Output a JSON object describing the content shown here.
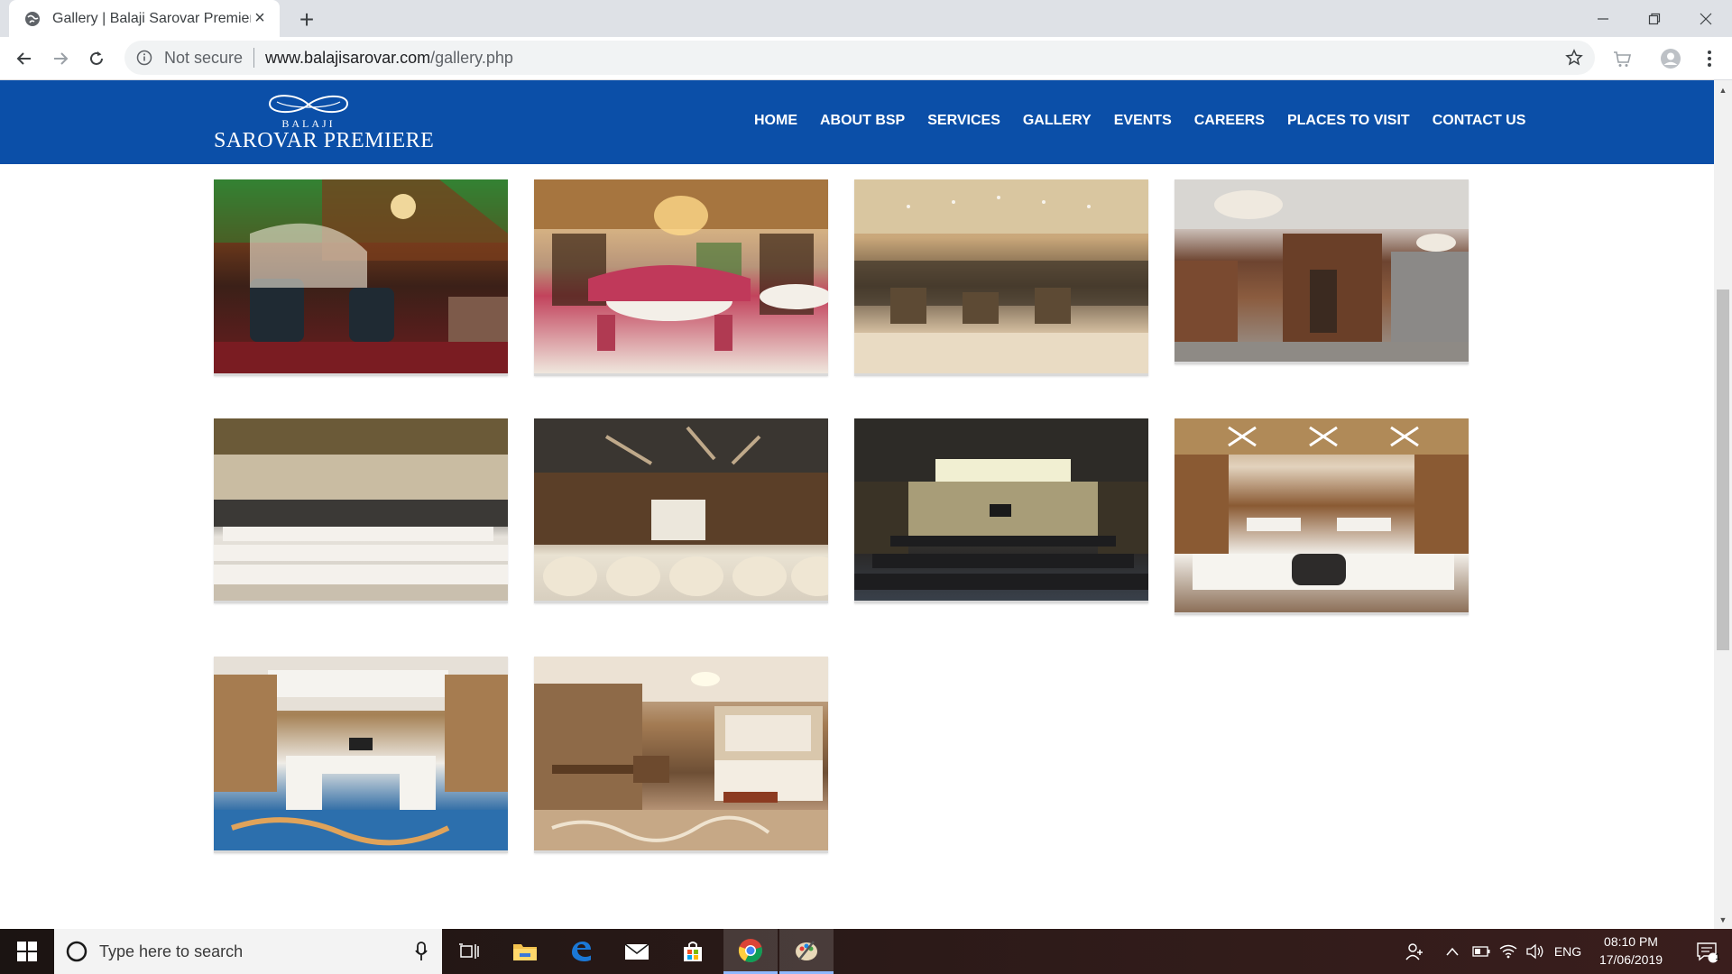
{
  "browser": {
    "tab_title": "Gallery | Balaji Sarovar Premiere",
    "omnibox": {
      "security_label": "Not secure",
      "url_host": "www.balajisarovar.com",
      "url_path": "/gallery.php"
    }
  },
  "site": {
    "logo": {
      "top_word": "BALAJI",
      "name": "SAROVAR PREMIERE"
    },
    "nav": [
      "HOME",
      "ABOUT BSP",
      "SERVICES",
      "GALLERY",
      "EVENTS",
      "CAREERS",
      "PLACES TO VISIT",
      "CONTACT US"
    ],
    "header_color": "#0b4fa8"
  },
  "gallery": {
    "photos": [
      {
        "subject": "restaurant-bar"
      },
      {
        "subject": "fine-dining-hall"
      },
      {
        "subject": "lounge"
      },
      {
        "subject": "lobby-corridor"
      },
      {
        "subject": "banquet-theatre-seating"
      },
      {
        "subject": "conference-hall-projector"
      },
      {
        "subject": "meeting-room-theatre"
      },
      {
        "subject": "boardroom-classroom"
      },
      {
        "subject": "u-shape-conference"
      },
      {
        "subject": "guest-room-suite"
      }
    ]
  },
  "taskbar": {
    "search_placeholder": "Type here to search",
    "language": "ENG",
    "time": "08:10 PM",
    "date": "17/06/2019",
    "notification_count": "1"
  }
}
